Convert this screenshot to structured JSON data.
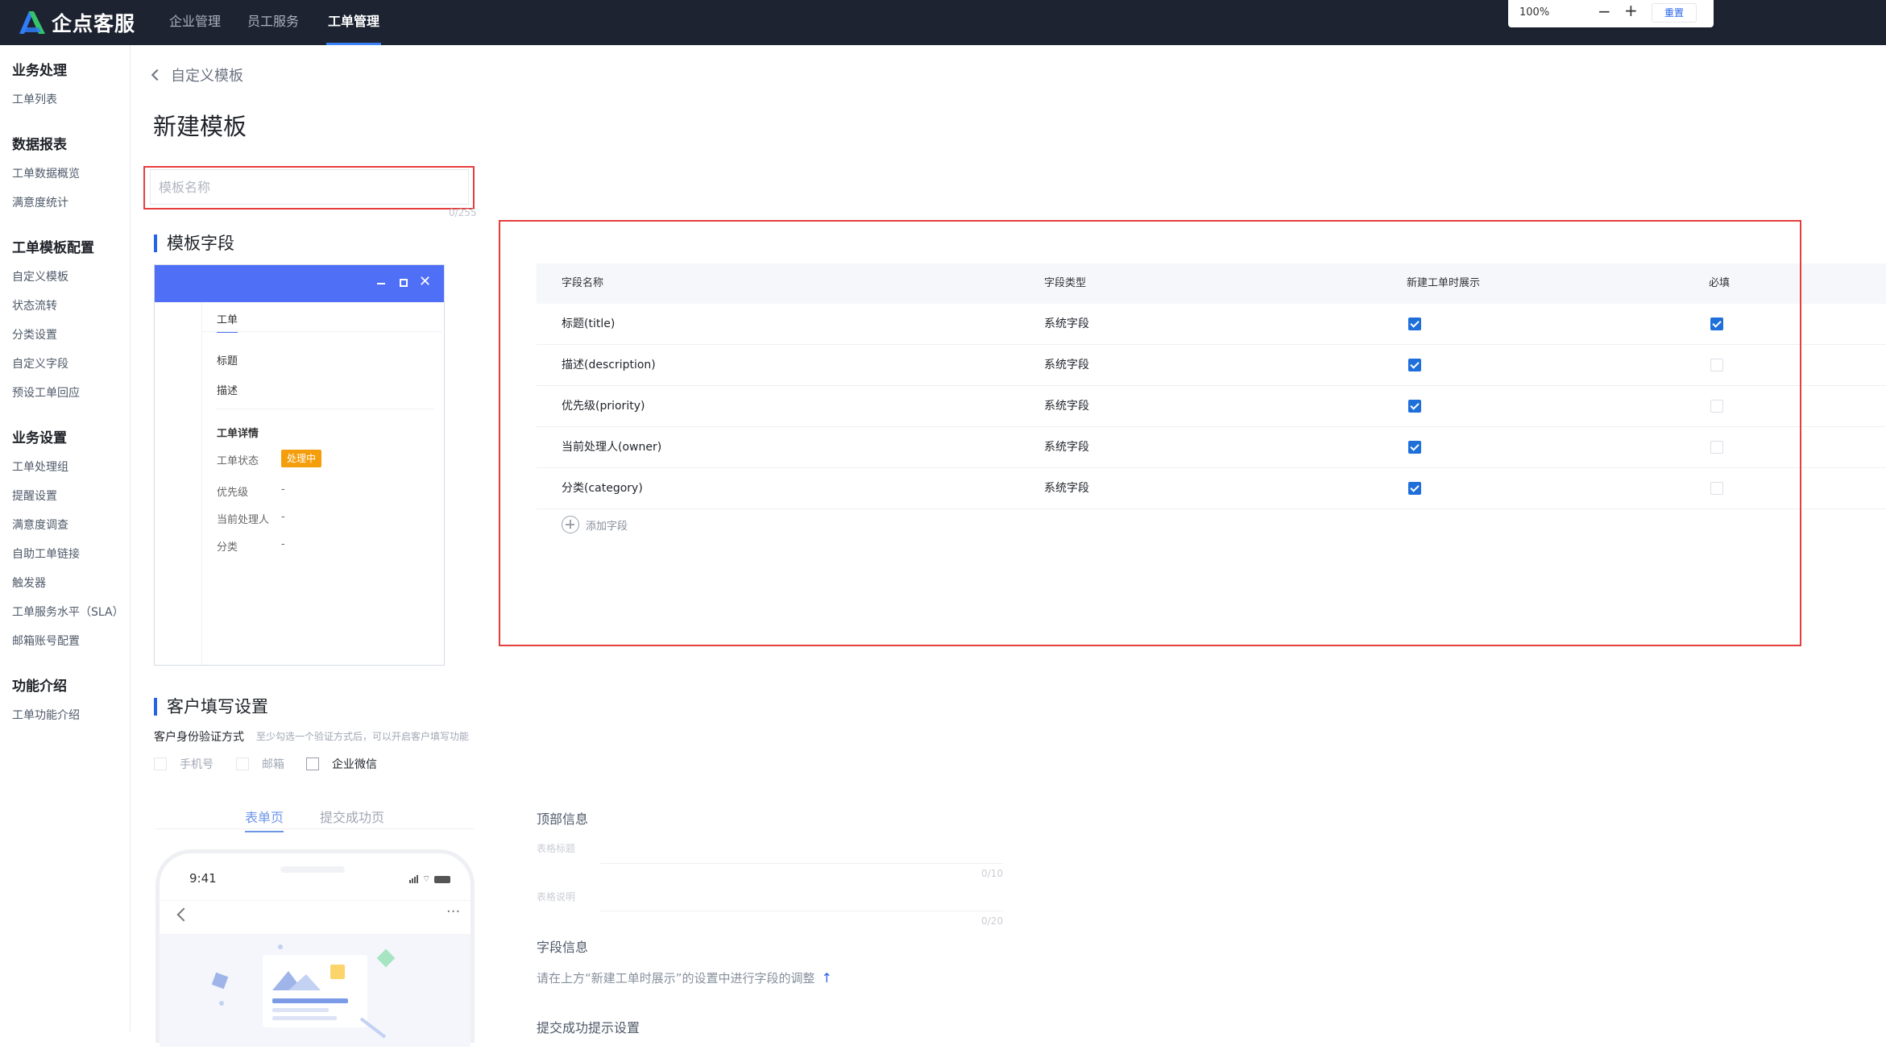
{
  "app": {
    "brand": "企点客服",
    "nav": [
      "企业管理",
      "员工服务",
      "工单管理"
    ],
    "active_nav": "工单管理"
  },
  "zoom": {
    "level": "100%",
    "minus": "−",
    "plus": "+",
    "reset": "重置"
  },
  "sidebar": {
    "groups": [
      {
        "title": "业务处理",
        "items": [
          "工单列表"
        ]
      },
      {
        "title": "数据报表",
        "items": [
          "工单数据概览",
          "满意度统计"
        ]
      },
      {
        "title": "工单模板配置",
        "items": [
          "自定义模板",
          "状态流转",
          "分类设置",
          "自定义字段",
          "预设工单回应"
        ]
      },
      {
        "title": "业务设置",
        "items": [
          "工单处理组",
          "提醒设置",
          "满意度调查",
          "自助工单链接",
          "触发器",
          "工单服务水平（SLA）",
          "邮箱账号配置"
        ]
      },
      {
        "title": "功能介绍",
        "items": [
          "工单功能介绍"
        ]
      }
    ]
  },
  "breadcrumb": {
    "back_label": "自定义模板"
  },
  "page_title": "新建模板",
  "name_input": {
    "placeholder": "模板名称",
    "value": "",
    "counter": "0/255"
  },
  "template_fields": {
    "title": "模板字段",
    "preview": {
      "tab": "工单",
      "rows": [
        "标题",
        "描述"
      ],
      "detail_title": "工单详情",
      "status_label": "工单状态",
      "status_badge": "处理中",
      "details": [
        {
          "label": "优先级",
          "value": "-"
        },
        {
          "label": "当前处理人",
          "value": "-"
        },
        {
          "label": "分类",
          "value": "-"
        }
      ]
    },
    "table": {
      "headers": [
        "字段名称",
        "字段类型",
        "新建工单时展示",
        "必填"
      ],
      "rows": [
        {
          "name": "标题(title)",
          "type": "系统字段",
          "show": true,
          "required": true
        },
        {
          "name": "描述(description)",
          "type": "系统字段",
          "show": true,
          "required": false
        },
        {
          "name": "优先级(priority)",
          "type": "系统字段",
          "show": true,
          "required": false
        },
        {
          "name": "当前处理人(owner)",
          "type": "系统字段",
          "show": true,
          "required": false
        },
        {
          "name": "分类(category)",
          "type": "系统字段",
          "show": true,
          "required": false
        }
      ],
      "add_field": "添加字段"
    }
  },
  "customer_settings": {
    "title": "客户填写设置",
    "verify_label": "客户身份验证方式",
    "verify_hint": "至少勾选一个验证方式后，可以开启客户填写功能",
    "options": [
      {
        "label": "手机号",
        "enabled": false
      },
      {
        "label": "邮箱",
        "enabled": false
      },
      {
        "label": "企业微信",
        "enabled": true
      }
    ],
    "tabs": [
      "表单页",
      "提交成功页"
    ],
    "active_tab": "表单页",
    "phone_time": "9:41",
    "form": {
      "top_info": "顶部信息",
      "form_title_placeholder": "表格标题",
      "form_title_counter": "0/10",
      "form_desc_placeholder": "表格说明",
      "form_desc_counter": "0/20",
      "field_info": "字段信息",
      "field_hint": "请在上方“新建工单时展示”的设置中进行字段的调整",
      "success_tip": "提交成功提示设置"
    }
  }
}
